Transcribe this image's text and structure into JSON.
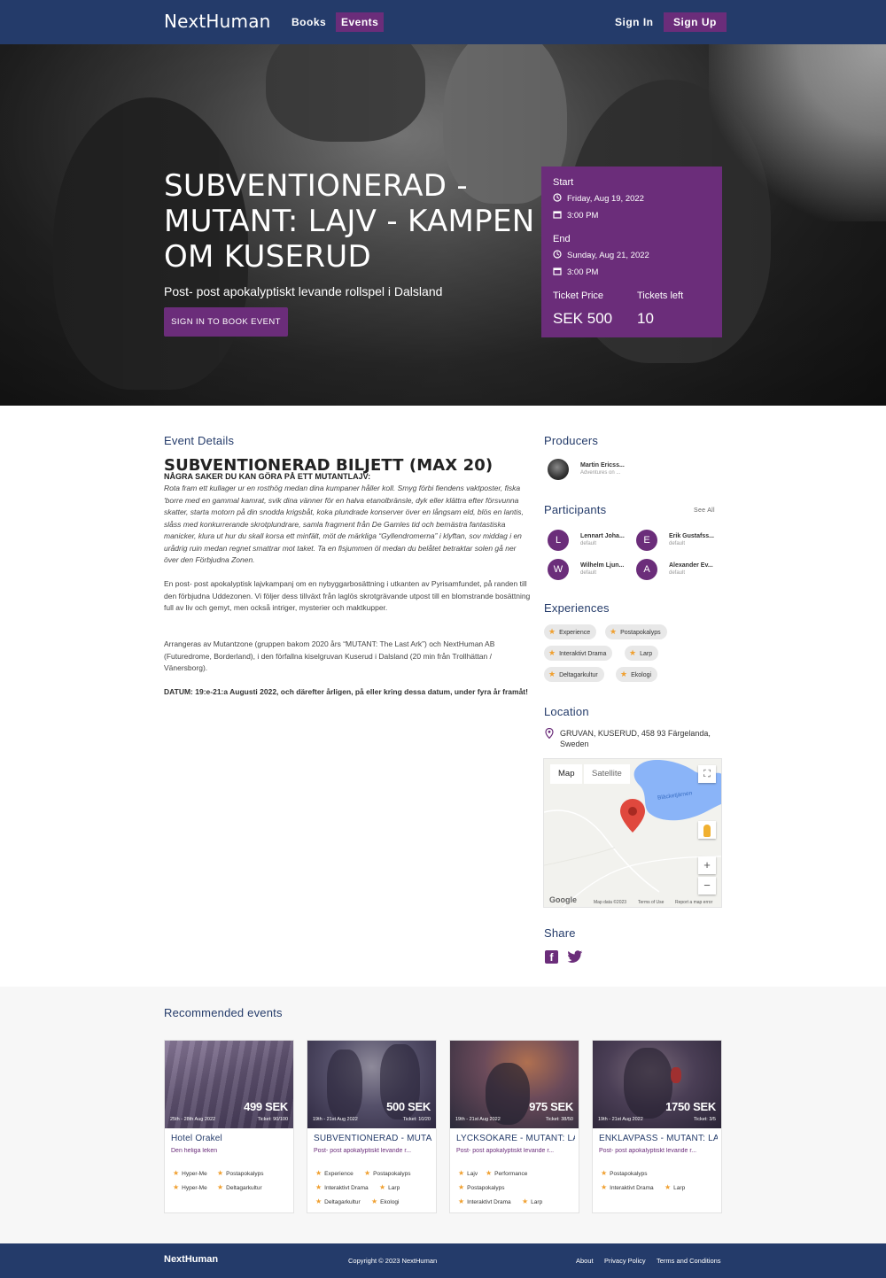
{
  "nav": {
    "brand": "NextHuman",
    "links": [
      {
        "label": "Books"
      },
      {
        "label": "Events"
      }
    ],
    "signin": "Sign In",
    "signup": "Sign Up"
  },
  "hero": {
    "title": "SUBVENTIONERAD - MUTANT: LAJV - KAMPEN OM KUSERUD",
    "subtitle": "Post- post apokalyptiskt levande rollspel i Dalsland",
    "button": "SIGN IN TO BOOK EVENT"
  },
  "event_card": {
    "start_label": "Start",
    "start_date": "Friday, Aug 19, 2022",
    "start_time": "3:00 PM",
    "end_label": "End",
    "end_date": "Sunday, Aug 21, 2022",
    "end_time": "3:00 PM",
    "price_label": "Ticket Price",
    "price": "SEK 500",
    "left_label": "Tickets left",
    "left": "10"
  },
  "details": {
    "heading": "Event Details",
    "title": "SUBVENTIONERAD BILJETT (MAX 20)",
    "subheading": "NÅGRA SAKER DU KAN GÖRA PÅ ETT MUTANTLAJV:",
    "paragraphs": [
      "Rota fram ett kullager ur en rosthög medan dina kumpaner håller koll. Smyg förbi fiendens vaktposter, fiska 'borre med en gammal kamrat, svik dina vänner för en halva etanolbränsle, dyk eller klättra efter försvunna skatter, starta motorn på din snodda krigsbåt, koka plundrade konserver över en långsam eld, blös en lantis, slåss med konkurrerande skrotplundrare, samla fragment från De Gamles tid och bemästra fantastiska manicker, klura ut hur du skall korsa ett minfält, möt de märkliga “Gyllendromerna” i klyftan, sov middag i en urådrig ruin medan regnet smattrar mot taket. Ta en fisjummen öl medan du belåtet betraktar solen gå ner över den Förbjudna Zonen.",
      "En post- post apokalyptisk lajvkampanj om en nybyggarbosättning i utkanten av Pyrisamfundet, på randen till den förbjudna Uddezonen. Vi följer dess tillväxt från laglös skrotgrävande utpost till en blomstrande bosättning full av liv och gemyt, men också intriger, mysterier och maktkupper.",
      "Arrangeras av Mutantzone (gruppen bakom 2020 års “MUTANT: The Last Ark”) och NextHuman AB (Futuredrome, Borderland), i den förfallna kiselgruvan Kuserud i Dalsland (20 min från Trollhättan / Vänersborg).",
      "DATUM: 19:e-21:a Augusti 2022, och därefter årligen, på eller kring dessa datum, under fyra år framåt!"
    ]
  },
  "producers": {
    "heading": "Producers",
    "items": [
      {
        "name": "Martin Ericss...",
        "role": "Adventures on ..."
      }
    ]
  },
  "participants": {
    "heading": "Participants",
    "see_all": "See All",
    "items": [
      {
        "initial": "L",
        "name": "Lennart Joha...",
        "role": "default"
      },
      {
        "initial": "E",
        "name": "Erik Gustafss...",
        "role": "default"
      },
      {
        "initial": "W",
        "name": "Wilhelm Ljun...",
        "role": "default"
      },
      {
        "initial": "A",
        "name": "Alexander Ev...",
        "role": "default"
      }
    ]
  },
  "experiences": {
    "heading": "Experiences",
    "tags": [
      "Experience",
      "Postapokalyps",
      "Interaktivt Drama",
      "Larp",
      "Deltagarkultur",
      "Ekologi"
    ]
  },
  "location": {
    "heading": "Location",
    "address": "GRUVAN, KUSERUD, 458 93 Färgelanda, Sweden",
    "map_tab": "Map",
    "sat_tab": "Satellite",
    "lake": "Bläcketjärnen",
    "google": "Google",
    "map_data": "Map data ©2023",
    "terms": "Terms of Use",
    "report": "Report a map error"
  },
  "share": {
    "heading": "Share"
  },
  "recommended": {
    "heading": "Recommended events",
    "cards": [
      {
        "price": "499 SEK",
        "date": "25th - 28th Aug 2022",
        "tickets": "Ticket: 90/100",
        "title": "Hotel Orakel",
        "subtitle": "Den heliga leken",
        "tags": [
          "Hyper-Me",
          "Postapokalyps",
          "Hyper-Me",
          "Deltagarkultur"
        ]
      },
      {
        "price": "500 SEK",
        "date": "19th - 21st Aug 2022",
        "tickets": "Ticket: 10/20",
        "title": "SUBVENTIONERAD - MUTA...",
        "subtitle": "Post- post apokalyptiskt levande r...",
        "tags": [
          "Experience",
          "Postapokalyps",
          "Interaktivt Drama",
          "Larp",
          "Deltagarkultur",
          "Ekologi"
        ]
      },
      {
        "price": "975 SEK",
        "date": "19th - 21st Aug 2022",
        "tickets": "Ticket: 38/50",
        "title": "LYCKSÖKARE - MUTANT: LAJ...",
        "subtitle": "Post- post apokalyptiskt levande r...",
        "tags": [
          "Lajv",
          "Performance",
          "Postapokalyps",
          "Interaktivt Drama",
          "Larp"
        ]
      },
      {
        "price": "1750 SEK",
        "date": "19th - 21st Aug 2022",
        "tickets": "Ticket: 3/5",
        "title": "ENKLAVPASS - MUTANT: LAJ...",
        "subtitle": "Post- post apokalyptiskt levande r...",
        "tags": [
          "Postapokalyps",
          "Interaktivt Drama",
          "Larp"
        ]
      }
    ]
  },
  "footer": {
    "brand": "NextHuman",
    "copyright": "Copyright © 2023 NextHuman",
    "links": [
      "About",
      "Privacy Policy",
      "Terms and Conditions"
    ]
  },
  "colors": {
    "navy": "#243b6a",
    "purple": "#6b2d7a",
    "star": "#f0a030"
  }
}
